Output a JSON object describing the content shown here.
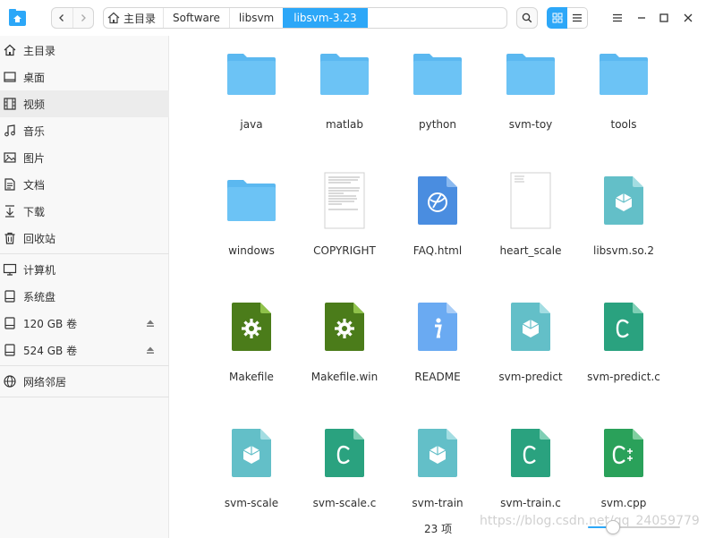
{
  "breadcrumb": [
    "主目录",
    "Software",
    "libsvm",
    "libsvm-3.23"
  ],
  "sidebar": {
    "items": [
      {
        "label": "主目录",
        "icon": "home-icon"
      },
      {
        "label": "桌面",
        "icon": "desktop-icon"
      },
      {
        "label": "视频",
        "icon": "video-icon"
      },
      {
        "label": "音乐",
        "icon": "music-icon"
      },
      {
        "label": "图片",
        "icon": "picture-icon"
      },
      {
        "label": "文档",
        "icon": "document-icon"
      },
      {
        "label": "下载",
        "icon": "download-icon"
      },
      {
        "label": "回收站",
        "icon": "trash-icon"
      },
      {
        "label": "计算机",
        "icon": "computer-icon"
      },
      {
        "label": "系统盘",
        "icon": "disk-icon"
      },
      {
        "label": "120 GB 卷",
        "icon": "disk-icon"
      },
      {
        "label": "524 GB 卷",
        "icon": "disk-icon"
      },
      {
        "label": "网络邻居",
        "icon": "network-icon"
      }
    ]
  },
  "files": [
    {
      "name": "java",
      "type": "folder"
    },
    {
      "name": "matlab",
      "type": "folder"
    },
    {
      "name": "python",
      "type": "folder"
    },
    {
      "name": "svm-toy",
      "type": "folder"
    },
    {
      "name": "tools",
      "type": "folder"
    },
    {
      "name": "windows",
      "type": "folder"
    },
    {
      "name": "COPYRIGHT",
      "type": "text-preview"
    },
    {
      "name": "FAQ.html",
      "type": "html"
    },
    {
      "name": "heart_scale",
      "type": "text-blank"
    },
    {
      "name": "libsvm.so.2",
      "type": "shared-lib"
    },
    {
      "name": "Makefile",
      "type": "makefile"
    },
    {
      "name": "Makefile.win",
      "type": "makefile"
    },
    {
      "name": "README",
      "type": "readme"
    },
    {
      "name": "svm-predict",
      "type": "executable"
    },
    {
      "name": "svm-predict.c",
      "type": "c-source"
    },
    {
      "name": "svm-scale",
      "type": "executable"
    },
    {
      "name": "svm-scale.c",
      "type": "c-source"
    },
    {
      "name": "svm-train",
      "type": "executable"
    },
    {
      "name": "svm-train.c",
      "type": "c-source"
    },
    {
      "name": "svm.cpp",
      "type": "cpp-source"
    }
  ],
  "status": {
    "count": "23 项"
  },
  "watermark": "https://blog.csdn.net/qq_24059779",
  "colors": {
    "accent": "#2ca7f8",
    "folder": "#6cc3f5",
    "executable": "#63bfc8",
    "c_source": "#2aa27f",
    "cpp_source": "#2aa15a",
    "makefile": "#4b7c1a",
    "html": "#4a8de0",
    "readme": "#6aaaf2"
  }
}
